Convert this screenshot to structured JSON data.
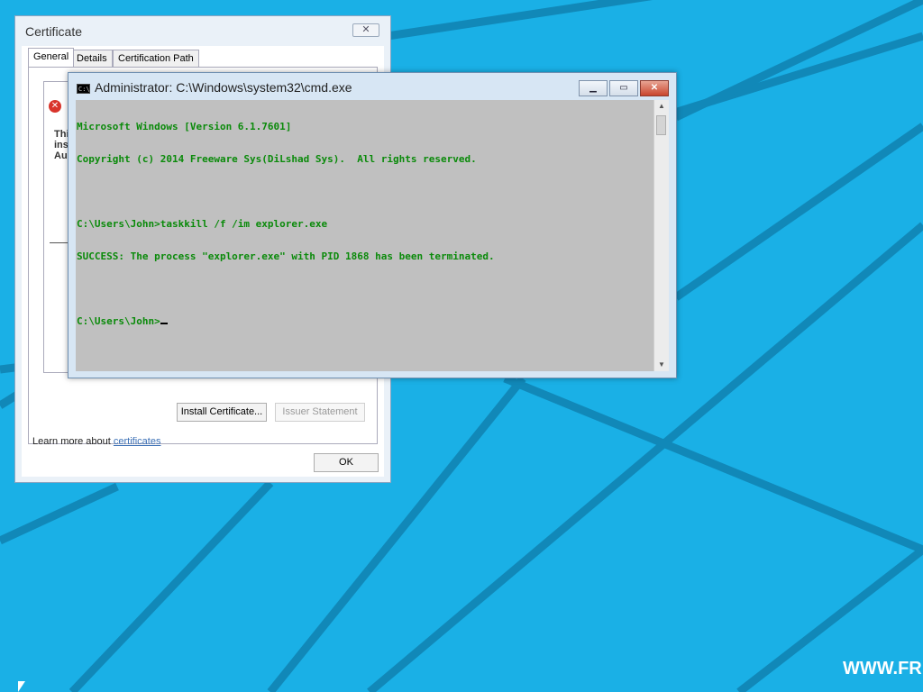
{
  "colors": {
    "desktop": "#1ab0e6",
    "desktop_lines": "#1188b8",
    "console_bg": "#c0c0c0",
    "console_text": "#0a8a0a"
  },
  "certificate": {
    "title": "Certificate",
    "close_icon": "close-icon",
    "tabs": [
      "General",
      "Details",
      "Certification Path"
    ],
    "fragments": [
      "Thi",
      "ins",
      "Au"
    ],
    "install_button": "Install Certificate...",
    "issuer_button": "Issuer Statement",
    "learn_prefix": "Learn more about ",
    "learn_link": "certificates",
    "ok_button": "OK"
  },
  "cmd": {
    "title": "Administrator: C:\\Windows\\system32\\cmd.exe",
    "icon": "cmd-icon",
    "minimize_icon": "minimize-icon",
    "maximize_icon": "maximize-icon",
    "close_icon": "close-icon",
    "lines": [
      "Microsoft Windows [Version 6.1.7601]",
      "Copyright (c) 2014 Freeware Sys(DiLshad Sys).  All rights reserved.",
      "",
      "C:\\Users\\John>taskkill /f /im explorer.exe",
      "SUCCESS: The process \"explorer.exe\" with PID 1868 has been terminated.",
      "",
      "C:\\Users\\John>"
    ]
  },
  "watermark": "WWW.FR"
}
